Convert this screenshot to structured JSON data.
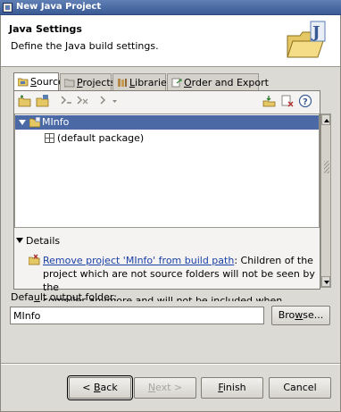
{
  "window": {
    "title": "New Java Project"
  },
  "header": {
    "title": "Java Settings",
    "description": "Define the Java build settings."
  },
  "tabs": [
    {
      "label": "Source",
      "mnemonic": "S",
      "rest": "ource",
      "active": true
    },
    {
      "label": "Projects",
      "mnemonic": "P",
      "rest": "rojects",
      "active": false
    },
    {
      "label": "Libraries",
      "mnemonic": "L",
      "rest": "ibraries",
      "active": false
    },
    {
      "label": "Order and Export",
      "mnemonic": "O",
      "rest": "rder and Export",
      "active": false
    }
  ],
  "tree": {
    "root": "MInfo",
    "child": "(default package)"
  },
  "details": {
    "label": "Details",
    "link": "Remove project 'MInfo' from build path",
    "text_part1": ": Children of the",
    "text_part2": "project which are not source folders will not be seen by the",
    "text_part3": "compiler anymore and will not be included when building the"
  },
  "output": {
    "label_pre": "Defa",
    "label_mnemonic": "u",
    "label_post": "lt output folder:",
    "value": "MInfo",
    "browse_pre": "Bro",
    "browse_mnemonic": "w",
    "browse_post": "se..."
  },
  "buttons": {
    "back_pre": "< ",
    "back_mnemonic": "B",
    "back_post": "ack",
    "next_pre": "",
    "next_mnemonic": "N",
    "next_post": "ext >",
    "finish_pre": "",
    "finish_mnemonic": "F",
    "finish_post": "inish",
    "cancel": "Cancel"
  },
  "colors": {
    "selection": "#4b6aa5",
    "link": "#1a3fa7",
    "titlebar": "#3a5a94"
  }
}
